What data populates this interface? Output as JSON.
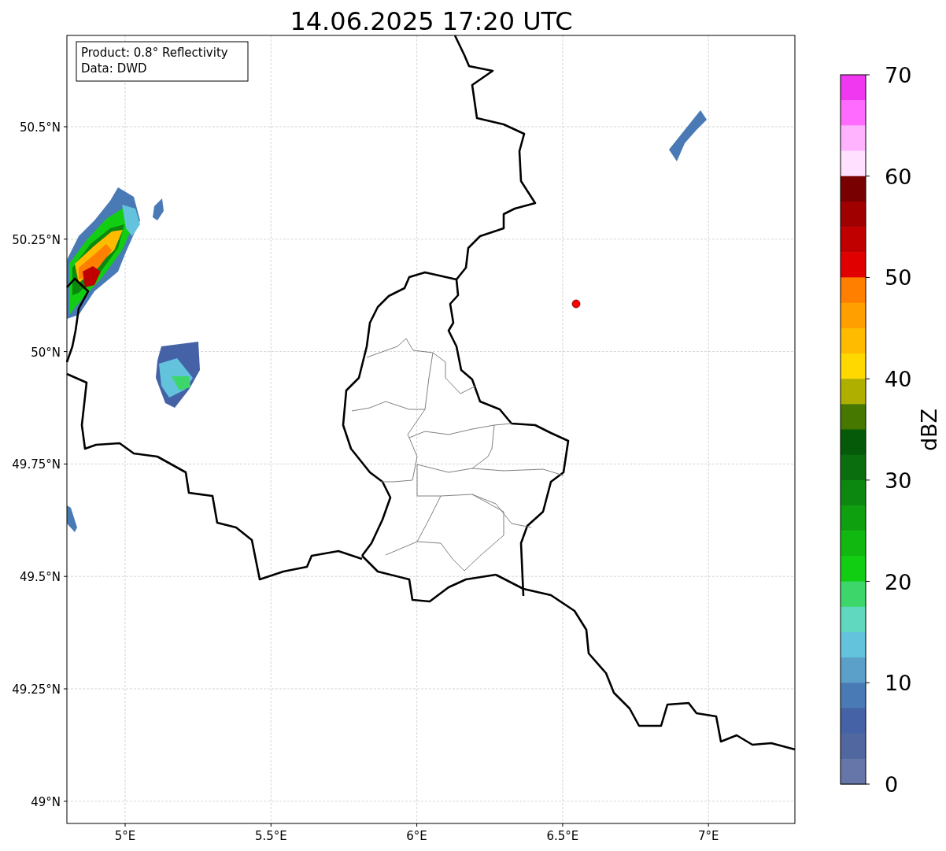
{
  "title": "14.06.2025 17:20 UTC",
  "info_box": {
    "lines": [
      "Product: 0.8° Reflectivity",
      "Data: DWD"
    ]
  },
  "map": {
    "x_ticks": [
      "5°E",
      "5.5°E",
      "6°E",
      "6.5°E",
      "7°E"
    ],
    "y_ticks": [
      "50.5°N",
      "50.25°N",
      "50°N",
      "49.75°N",
      "49.5°N",
      "49.25°N",
      "49°N"
    ]
  },
  "colorbar": {
    "label": "dBZ",
    "ticks": [
      "70",
      "60",
      "50",
      "40",
      "30",
      "20",
      "10",
      "0"
    ],
    "bins": [
      {
        "color": "#ef38ef"
      },
      {
        "color": "#ff6bff"
      },
      {
        "color": "#ffb3ff"
      },
      {
        "color": "#ffe0ff"
      },
      {
        "color": "#780000"
      },
      {
        "color": "#a00000"
      },
      {
        "color": "#c00000"
      },
      {
        "color": "#e00000"
      },
      {
        "color": "#ff7f00"
      },
      {
        "color": "#ff9f00"
      },
      {
        "color": "#ffbb00"
      },
      {
        "color": "#ffd800"
      },
      {
        "color": "#afaf00"
      },
      {
        "color": "#467800"
      },
      {
        "color": "#055a0a"
      },
      {
        "color": "#0a6e0f"
      },
      {
        "color": "#0c870f"
      },
      {
        "color": "#0ea00f"
      },
      {
        "color": "#10b810"
      },
      {
        "color": "#12ce12"
      },
      {
        "color": "#3cd66a"
      },
      {
        "color": "#60d8c0"
      },
      {
        "color": "#63c3dd"
      },
      {
        "color": "#5ba0c8"
      },
      {
        "color": "#4a7ab5"
      },
      {
        "color": "#4462a5"
      },
      {
        "color": "#50689f"
      },
      {
        "color": "#6676a8"
      }
    ]
  }
}
